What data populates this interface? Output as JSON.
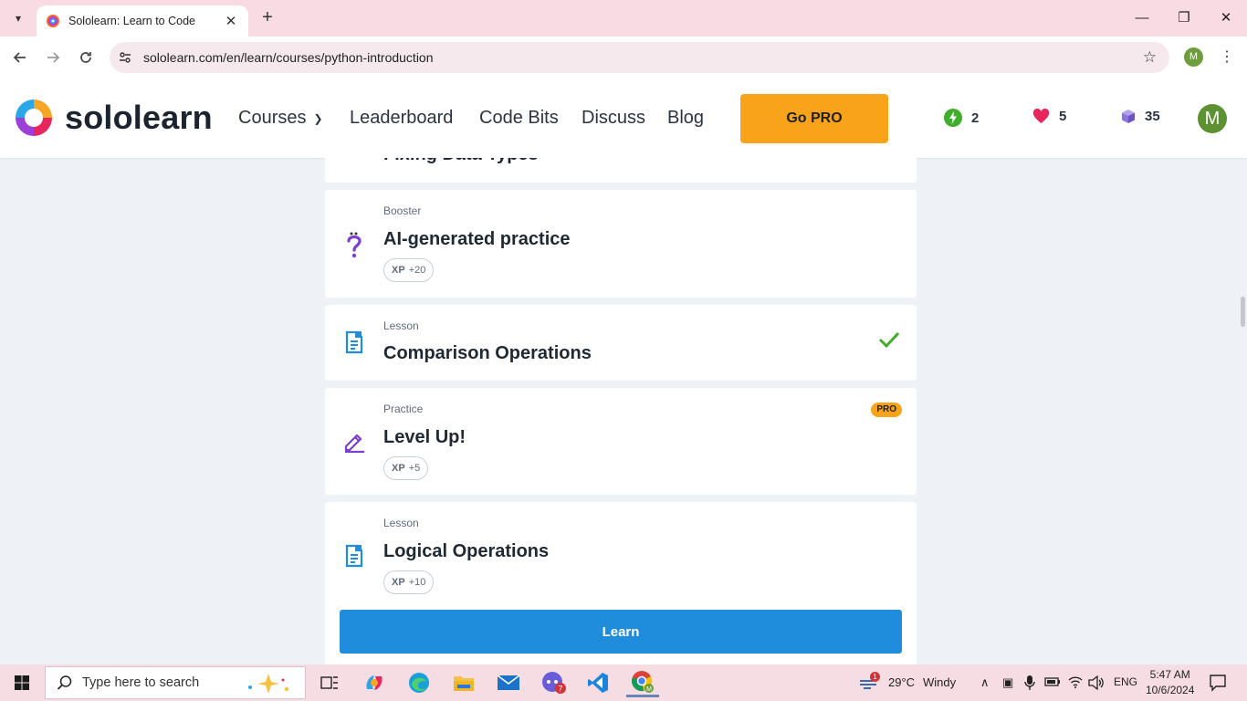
{
  "browser": {
    "tab_title": "Sololearn: Learn to Code",
    "url": "sololearn.com/en/learn/courses/python-introduction",
    "profile_initial": "M",
    "icons": [
      "tab-list-icon",
      "close-icon",
      "new-tab-icon",
      "minimize-icon",
      "restore-icon",
      "back-icon",
      "forward-icon",
      "reload-icon",
      "site-info-icon",
      "bookmark-star-icon",
      "more-icon"
    ]
  },
  "header": {
    "logo_text": "sololearn",
    "nav": {
      "courses": "Courses",
      "leaderboard": "Leaderboard",
      "code_bits": "Code Bits",
      "discuss": "Discuss",
      "blog": "Blog"
    },
    "go_pro": "Go PRO",
    "streak": "2",
    "hearts": "5",
    "gems": "35",
    "avatar_initial": "M",
    "colors": {
      "accent": "#f8a31a",
      "streak": "#3fae2a",
      "heart": "#e8265e",
      "gem": "#8f73d9"
    }
  },
  "content": {
    "partial_title": "Fixing Data Types",
    "cards": [
      {
        "kind": "Booster",
        "title": "AI-generated practice",
        "xp_label": "XP",
        "xp_value": "+20",
        "icon": "question-icon"
      },
      {
        "kind": "Lesson",
        "title": "Comparison Operations",
        "icon": "lesson-icon",
        "status": "completed"
      },
      {
        "kind": "Practice",
        "title": "Level Up!",
        "xp_label": "XP",
        "xp_value": "+5",
        "badge": "PRO",
        "icon": "pencil-icon"
      },
      {
        "kind": "Lesson",
        "title": "Logical Operations",
        "xp_label": "XP",
        "xp_value": "+10",
        "icon": "lesson-icon"
      }
    ],
    "learn_button": "Learn"
  },
  "taskbar": {
    "search_placeholder": "Type here to search",
    "weather_temp": "29°C",
    "weather_desc": "Windy",
    "language": "ENG",
    "time": "5:47 AM",
    "date": "10/6/2024",
    "notification_count": "1",
    "discord_badge": "7",
    "chrome_profile_initial": "M"
  }
}
